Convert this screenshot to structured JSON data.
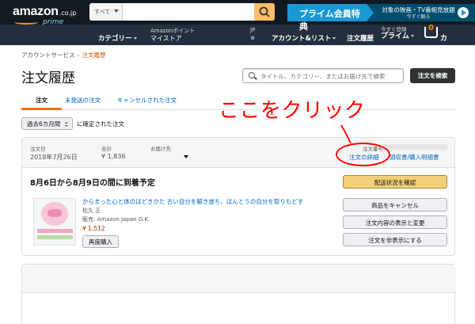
{
  "header": {
    "logo_main": "amazon",
    "logo_tld": ".co.jp",
    "logo_sub": "prime",
    "search_category": "すべて",
    "prime_banner_title": "プライム会員特典",
    "prime_banner_line1": "対象の映画・TV番組見放題",
    "prime_banner_line2": "今すぐ観る",
    "nav": {
      "category": "カテゴリー",
      "points_line1": "Amazonポイント",
      "points_line2": "マイストア",
      "lang_line1": "JP",
      "lang_line2": "⊕",
      "account": "アカウント&リスト",
      "orders": "注文履歴",
      "prime_line1": "今すぐ登録",
      "prime_line2": "プライム",
      "cart_count": "0",
      "cart": "カート"
    }
  },
  "breadcrumb": {
    "parent": "アカウントサービス",
    "separator": "›",
    "current": "注文履歴"
  },
  "page_title": "注文履歴",
  "order_search": {
    "placeholder": "タイトル、カテゴリー、またはお届け先で検索",
    "button": "注文を検索"
  },
  "tabs": [
    {
      "label": "注文"
    },
    {
      "label": "未発送の注文"
    },
    {
      "label": "キャンセルされた注文"
    }
  ],
  "filter": {
    "period": "過去6カ月間",
    "label": "に確定された注文"
  },
  "order": {
    "date_label": "注文日",
    "date": "2018年7月26日",
    "total_label": "合計",
    "total": "¥ 1,836",
    "ship_label": "お届け先",
    "number_label": "注文番号",
    "detail_link": "注文の詳細",
    "link_divider": "|",
    "receipt_link": "領収書/購入明細書",
    "delivery_status": "8月6日から8月9日の間に到着予定",
    "item": {
      "title": "からまった心と体のほどきかた 古い自分を解き放ち、ほんとうの自分を取りもどす",
      "author": "松久 正",
      "seller": "販売: Amazon Japan G.K.",
      "price": "¥ 1,512",
      "rebuy": "再度購入"
    },
    "actions": [
      {
        "label": "配送状況を確認"
      },
      {
        "label": "商品をキャンセル"
      },
      {
        "label": "注文内容の表示と変更"
      },
      {
        "label": "注文を非表示にする"
      }
    ]
  },
  "annotation": {
    "text": "ここをクリック",
    "color": "#ff0000"
  },
  "colors": {
    "header_bg": "#232f3e",
    "topbar_bg": "#131921",
    "accent_orange": "#ff9900",
    "link_blue": "#0066c0",
    "price_red": "#b12704",
    "primary_button": "#f3d078"
  }
}
